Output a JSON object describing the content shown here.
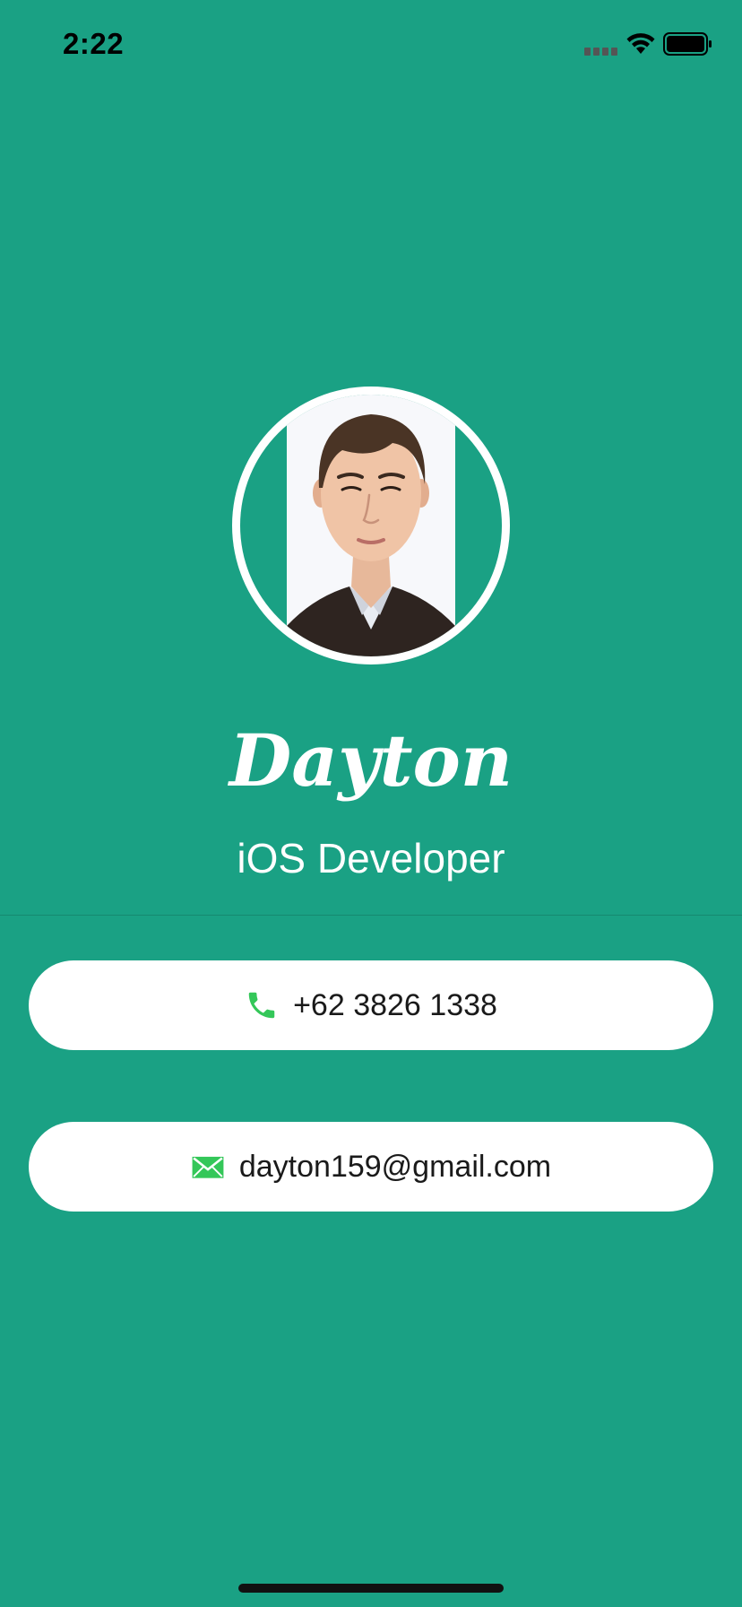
{
  "status_bar": {
    "time": "2:22"
  },
  "profile": {
    "name": "Dayton",
    "title": "iOS Developer"
  },
  "contacts": {
    "phone": {
      "icon": "phone-icon",
      "value": "+62 3826 1338"
    },
    "email": {
      "icon": "envelope-icon",
      "value": "dayton159@gmail.com"
    }
  },
  "colors": {
    "background": "#1aa184",
    "card": "#ffffff",
    "icon_green": "#34c759"
  }
}
